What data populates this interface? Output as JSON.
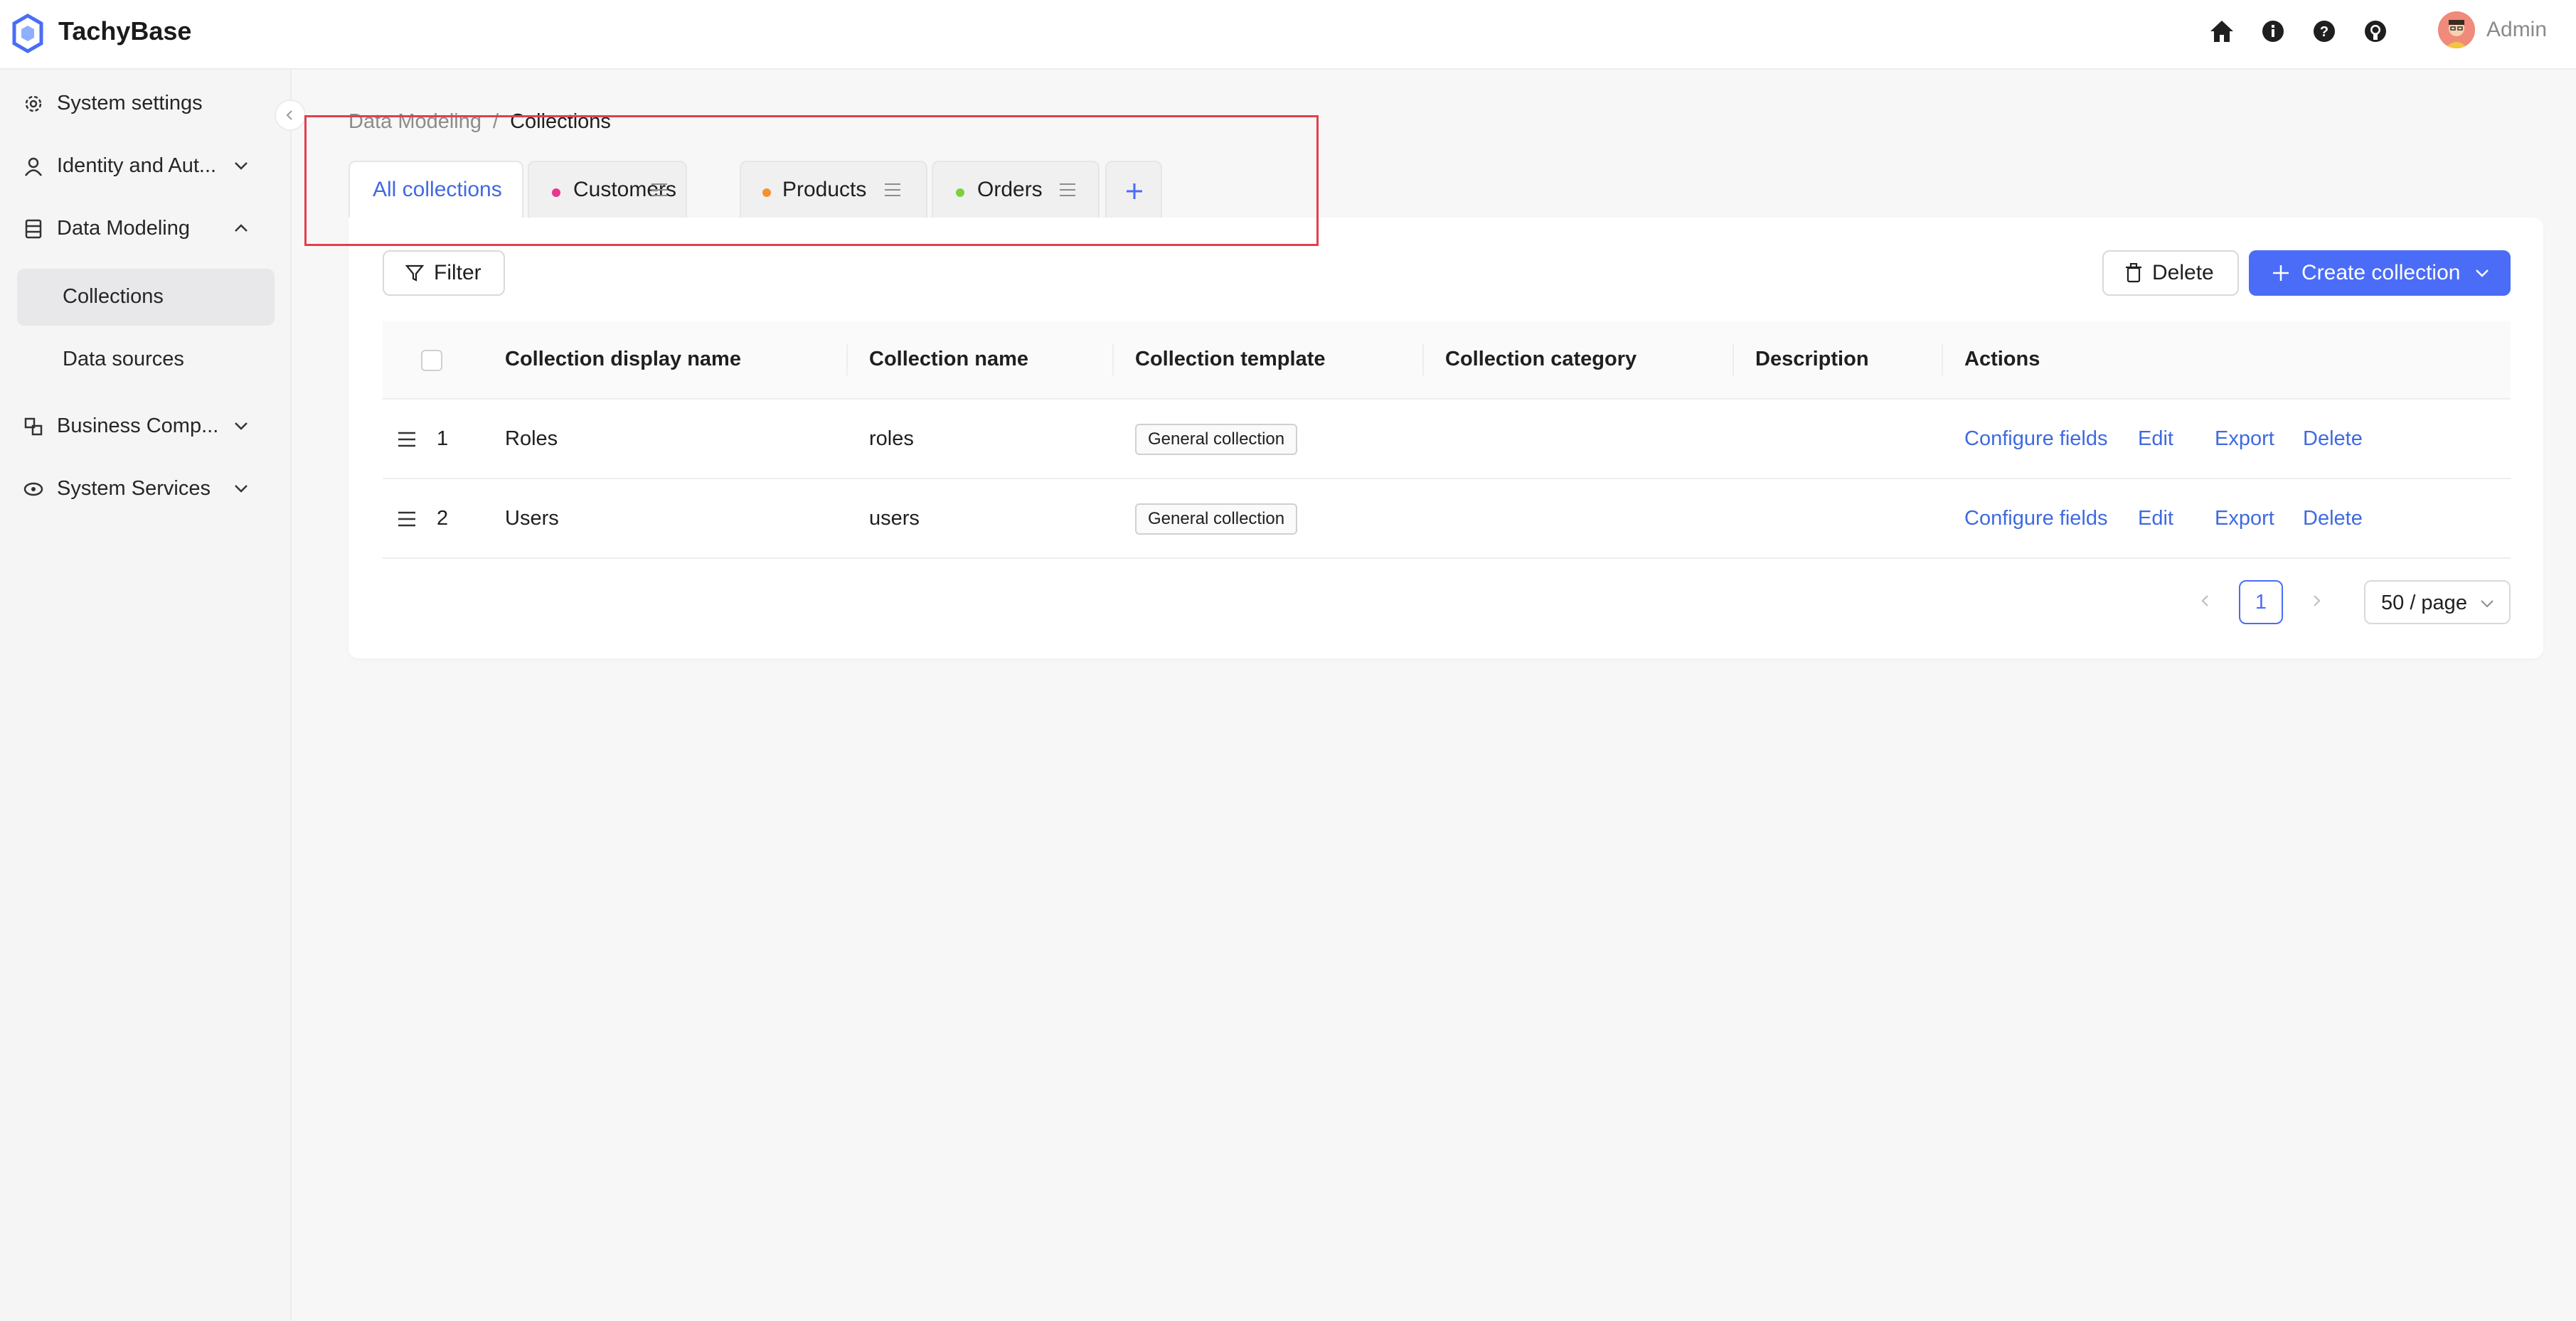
{
  "app": {
    "name": "TachyBase"
  },
  "header": {
    "user_name": "Admin",
    "icons": [
      "home-icon",
      "info-icon",
      "help-icon",
      "github-icon"
    ]
  },
  "sidebar": {
    "items": [
      {
        "label": "System settings",
        "icon": "gear-icon",
        "expandable": false
      },
      {
        "label": "Identity and Aut...",
        "icon": "user-icon",
        "expandable": true
      },
      {
        "label": "Data Modeling",
        "icon": "database-icon",
        "expandable": true,
        "expanded": true
      },
      {
        "label": "Business Comp...",
        "icon": "components-icon",
        "expandable": true
      },
      {
        "label": "System Services",
        "icon": "cloud-icon",
        "expandable": true
      }
    ],
    "sub_items": [
      {
        "label": "Collections",
        "active": true
      },
      {
        "label": "Data sources",
        "active": false
      }
    ]
  },
  "breadcrumb": {
    "parent": "Data Modeling",
    "separator": "/",
    "current": "Collections"
  },
  "tabs": [
    {
      "label": "All collections",
      "active": true
    },
    {
      "label": "Customers",
      "color": "#e8358f"
    },
    {
      "label": "Products",
      "color": "#f5922e"
    },
    {
      "label": "Orders",
      "color": "#7cd13a"
    }
  ],
  "toolbar": {
    "filter_label": "Filter",
    "delete_label": "Delete",
    "create_label": "Create collection"
  },
  "table": {
    "columns": [
      "Collection display name",
      "Collection name",
      "Collection template",
      "Collection category",
      "Description",
      "Actions"
    ],
    "rows": [
      {
        "index": "1",
        "display_name": "Roles",
        "name": "roles",
        "template": "General collection",
        "category": "",
        "description": ""
      },
      {
        "index": "2",
        "display_name": "Users",
        "name": "users",
        "template": "General collection",
        "category": "",
        "description": ""
      }
    ],
    "actions": [
      "Configure fields",
      "Edit",
      "Export",
      "Delete"
    ]
  },
  "pagination": {
    "current_page": "1",
    "page_size": "50 / page"
  },
  "colors": {
    "primary": "#4a6cf7",
    "link": "#3f6ae0",
    "highlight": "#e53e4b"
  }
}
